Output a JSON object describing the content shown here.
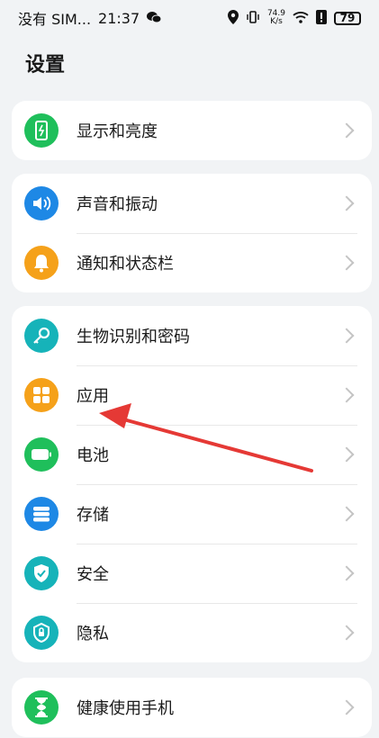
{
  "status": {
    "carrier": "没有 SIM...",
    "time": "21:37",
    "net_speed_top": "74.9",
    "net_speed_bottom": "K/s",
    "battery": "79"
  },
  "title": "设置",
  "groups": [
    {
      "items": [
        {
          "label": "显示和亮度",
          "icon": "display-icon",
          "color": "#1fbf5b"
        }
      ]
    },
    {
      "items": [
        {
          "label": "声音和振动",
          "icon": "sound-icon",
          "color": "#1e88e5"
        },
        {
          "label": "通知和状态栏",
          "icon": "bell-icon",
          "color": "#f5a11a"
        }
      ]
    },
    {
      "items": [
        {
          "label": "生物识别和密码",
          "icon": "key-icon",
          "color": "#16b3b9"
        },
        {
          "label": "应用",
          "icon": "apps-icon",
          "color": "#f5a11a"
        },
        {
          "label": "电池",
          "icon": "battery-icon",
          "color": "#1fbf5b"
        },
        {
          "label": "存储",
          "icon": "storage-icon",
          "color": "#1e88e5"
        },
        {
          "label": "安全",
          "icon": "shield-icon",
          "color": "#16b3b9"
        },
        {
          "label": "隐私",
          "icon": "privacy-lock-icon",
          "color": "#16b3b9"
        }
      ]
    },
    {
      "items": [
        {
          "label": "健康使用手机",
          "icon": "hourglass-icon",
          "color": "#1fbf5b"
        }
      ]
    }
  ],
  "annotation_color": "#e53935"
}
